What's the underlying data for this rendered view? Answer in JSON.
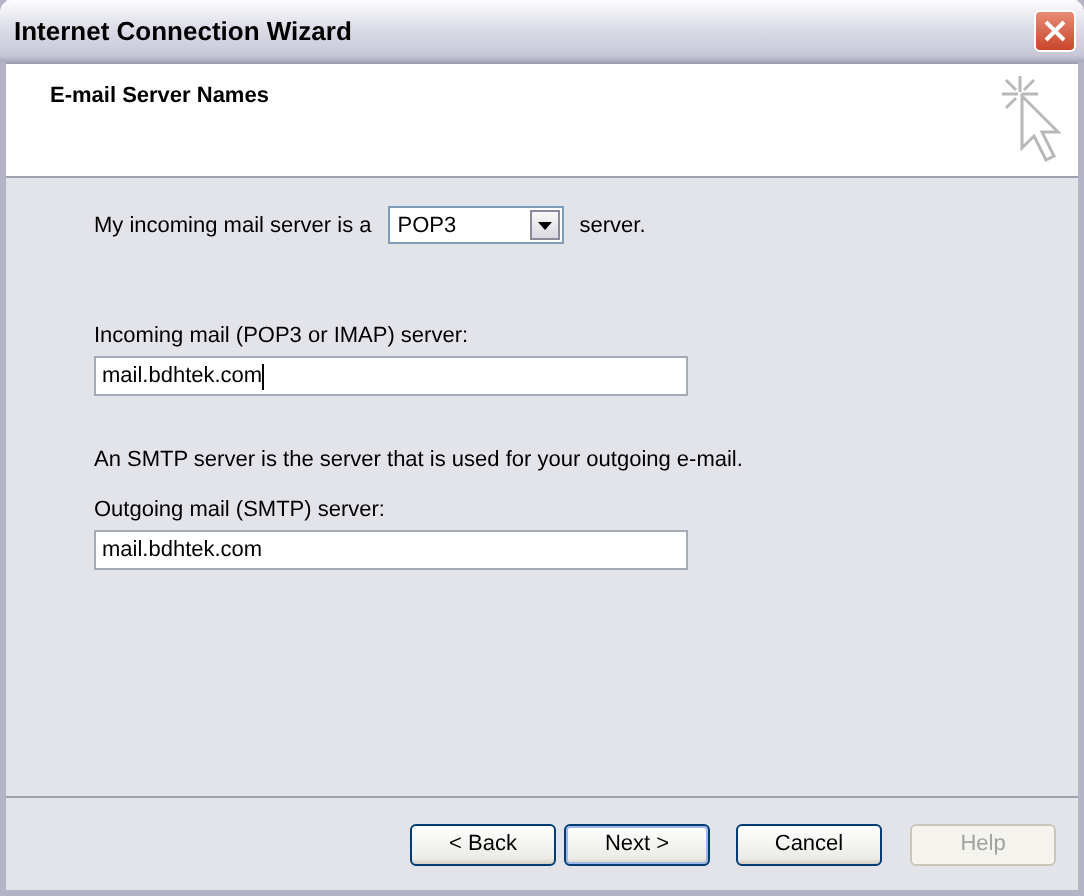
{
  "window": {
    "title": "Internet Connection Wizard"
  },
  "header": {
    "title": "E-mail Server Names"
  },
  "server_type": {
    "label_before": "My incoming mail server is a",
    "value": "POP3",
    "label_after": "server."
  },
  "fields": [
    {
      "label": "Incoming mail (POP3 or IMAP) server:",
      "value": "mail.bdhtek.com",
      "focused": true
    },
    {
      "note": "An SMTP server is the server that is used for your outgoing e-mail.",
      "label": "Outgoing mail (SMTP) server:",
      "value": "mail.bdhtek.com",
      "focused": false
    }
  ],
  "buttons": [
    {
      "label": "< Back",
      "disabled": false,
      "default": false
    },
    {
      "label": "Next >",
      "disabled": false,
      "default": true
    },
    {
      "label": "Cancel",
      "disabled": false,
      "default": false
    },
    {
      "label": "Help",
      "disabled": true,
      "default": false
    }
  ]
}
